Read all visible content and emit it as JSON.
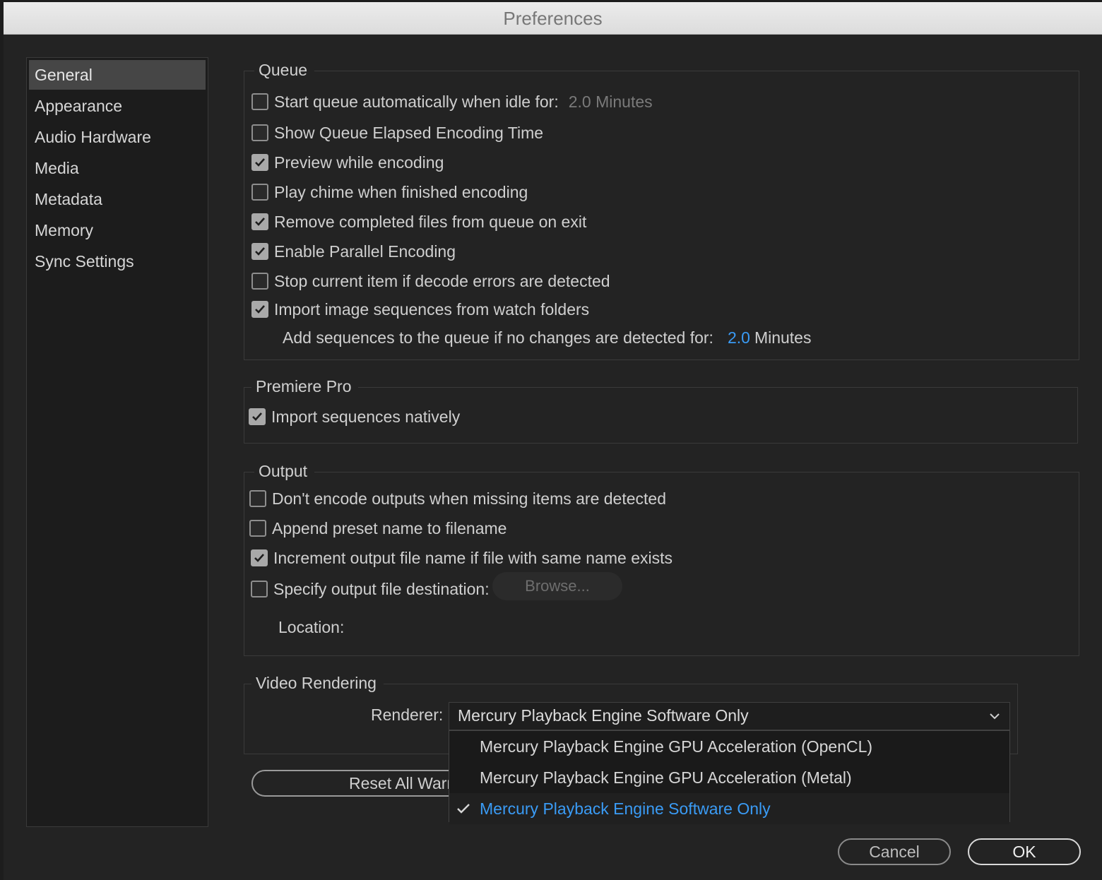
{
  "window": {
    "title": "Preferences"
  },
  "sidebar": {
    "items": [
      {
        "label": "General"
      },
      {
        "label": "Appearance"
      },
      {
        "label": "Audio Hardware"
      },
      {
        "label": "Media"
      },
      {
        "label": "Metadata"
      },
      {
        "label": "Memory"
      },
      {
        "label": "Sync Settings"
      }
    ],
    "selected": "General"
  },
  "queue": {
    "title": "Queue",
    "start_auto": {
      "label": "Start queue automatically when idle for:",
      "checked": false,
      "value": "2.0 Minutes"
    },
    "show_elapsed": {
      "label": "Show Queue Elapsed Encoding Time",
      "checked": false
    },
    "preview": {
      "label": "Preview while encoding",
      "checked": true
    },
    "chime": {
      "label": "Play chime when finished encoding",
      "checked": false
    },
    "remove_completed": {
      "label": "Remove completed files from queue on exit",
      "checked": true
    },
    "parallel": {
      "label": "Enable Parallel Encoding",
      "checked": true
    },
    "stop_on_errors": {
      "label": "Stop current item if decode errors are detected",
      "checked": false
    },
    "import_sequences": {
      "label": "Import image sequences from watch folders",
      "checked": true
    },
    "add_sequences": {
      "label": "Add sequences to the queue if no changes are detected for:",
      "value": "2.0",
      "unit": "Minutes"
    }
  },
  "premiere": {
    "title": "Premiere Pro",
    "import_native": {
      "label": "Import sequences natively",
      "checked": true
    }
  },
  "output": {
    "title": "Output",
    "dont_encode": {
      "label": "Don't encode outputs when missing items are detected",
      "checked": false
    },
    "append_preset": {
      "label": "Append preset name to filename",
      "checked": false
    },
    "increment": {
      "label": "Increment output file name if file with same name exists",
      "checked": true
    },
    "specify_dest": {
      "label": "Specify output file destination:",
      "checked": false
    },
    "browse_label": "Browse...",
    "location_label": "Location:"
  },
  "video": {
    "title": "Video Rendering",
    "renderer_label": "Renderer:",
    "renderer_value": "Mercury Playback Engine Software Only",
    "options": [
      {
        "label": "Mercury Playback Engine GPU Acceleration (OpenCL)",
        "selected": false
      },
      {
        "label": "Mercury Playback Engine GPU Acceleration (Metal)",
        "selected": false
      },
      {
        "label": "Mercury Playback Engine Software Only",
        "selected": true
      }
    ]
  },
  "buttons": {
    "reset": "Reset All Warn",
    "cancel": "Cancel",
    "ok": "OK"
  },
  "colors": {
    "accent": "#3a9bf5",
    "background": "#232323",
    "titlebar": "#e4e4e4"
  },
  "icons": {
    "check": "check-icon",
    "chevron": "chevron-down-icon"
  }
}
